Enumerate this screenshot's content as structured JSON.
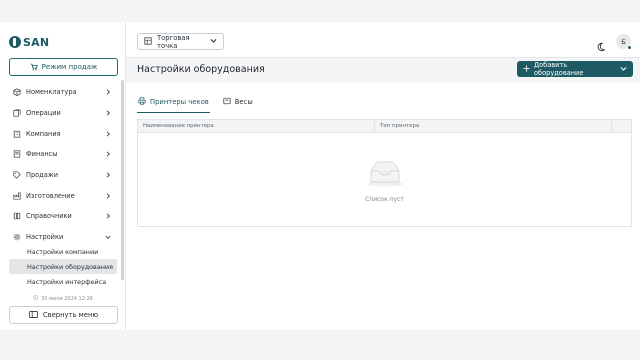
{
  "brand": {
    "name": "SAN"
  },
  "sidebar": {
    "sale_button": "Режим продаж",
    "items": [
      {
        "label": "Номенклатура",
        "icon": "box-icon",
        "expanded": false
      },
      {
        "label": "Операции",
        "icon": "operations-icon",
        "expanded": false
      },
      {
        "label": "Компания",
        "icon": "building-icon",
        "expanded": false
      },
      {
        "label": "Финансы",
        "icon": "wallet-icon",
        "expanded": false
      },
      {
        "label": "Продажи",
        "icon": "tag-icon",
        "expanded": false
      },
      {
        "label": "Изготовление",
        "icon": "production-icon",
        "expanded": false
      },
      {
        "label": "Справочники",
        "icon": "book-icon",
        "expanded": false
      },
      {
        "label": "Настройки",
        "icon": "settings-icon",
        "expanded": true
      }
    ],
    "sub_items": [
      {
        "label": "Настройки компании",
        "active": false
      },
      {
        "label": "Настройки оборудования",
        "active": true
      },
      {
        "label": "Настройки интерфейса",
        "active": false
      }
    ],
    "timestamp": "30 июля 2024 12:26",
    "collapse_button": "Свернуть меню"
  },
  "topbar": {
    "store_select": "Торговая точка",
    "avatar_initial": "Б"
  },
  "page": {
    "title": "Настройки оборудования",
    "add_button": "Добавить оборудование",
    "tabs": [
      {
        "label": "Принтеры чеков",
        "active": true,
        "icon": "printer-icon"
      },
      {
        "label": "Весы",
        "active": false,
        "icon": "scale-icon"
      }
    ],
    "table": {
      "columns": [
        "Наименование принтера",
        "Тип принтера",
        ""
      ],
      "empty_text": "Список пуст"
    }
  },
  "colors": {
    "accent": "#1e5a63",
    "background": "#f4f5f6"
  }
}
